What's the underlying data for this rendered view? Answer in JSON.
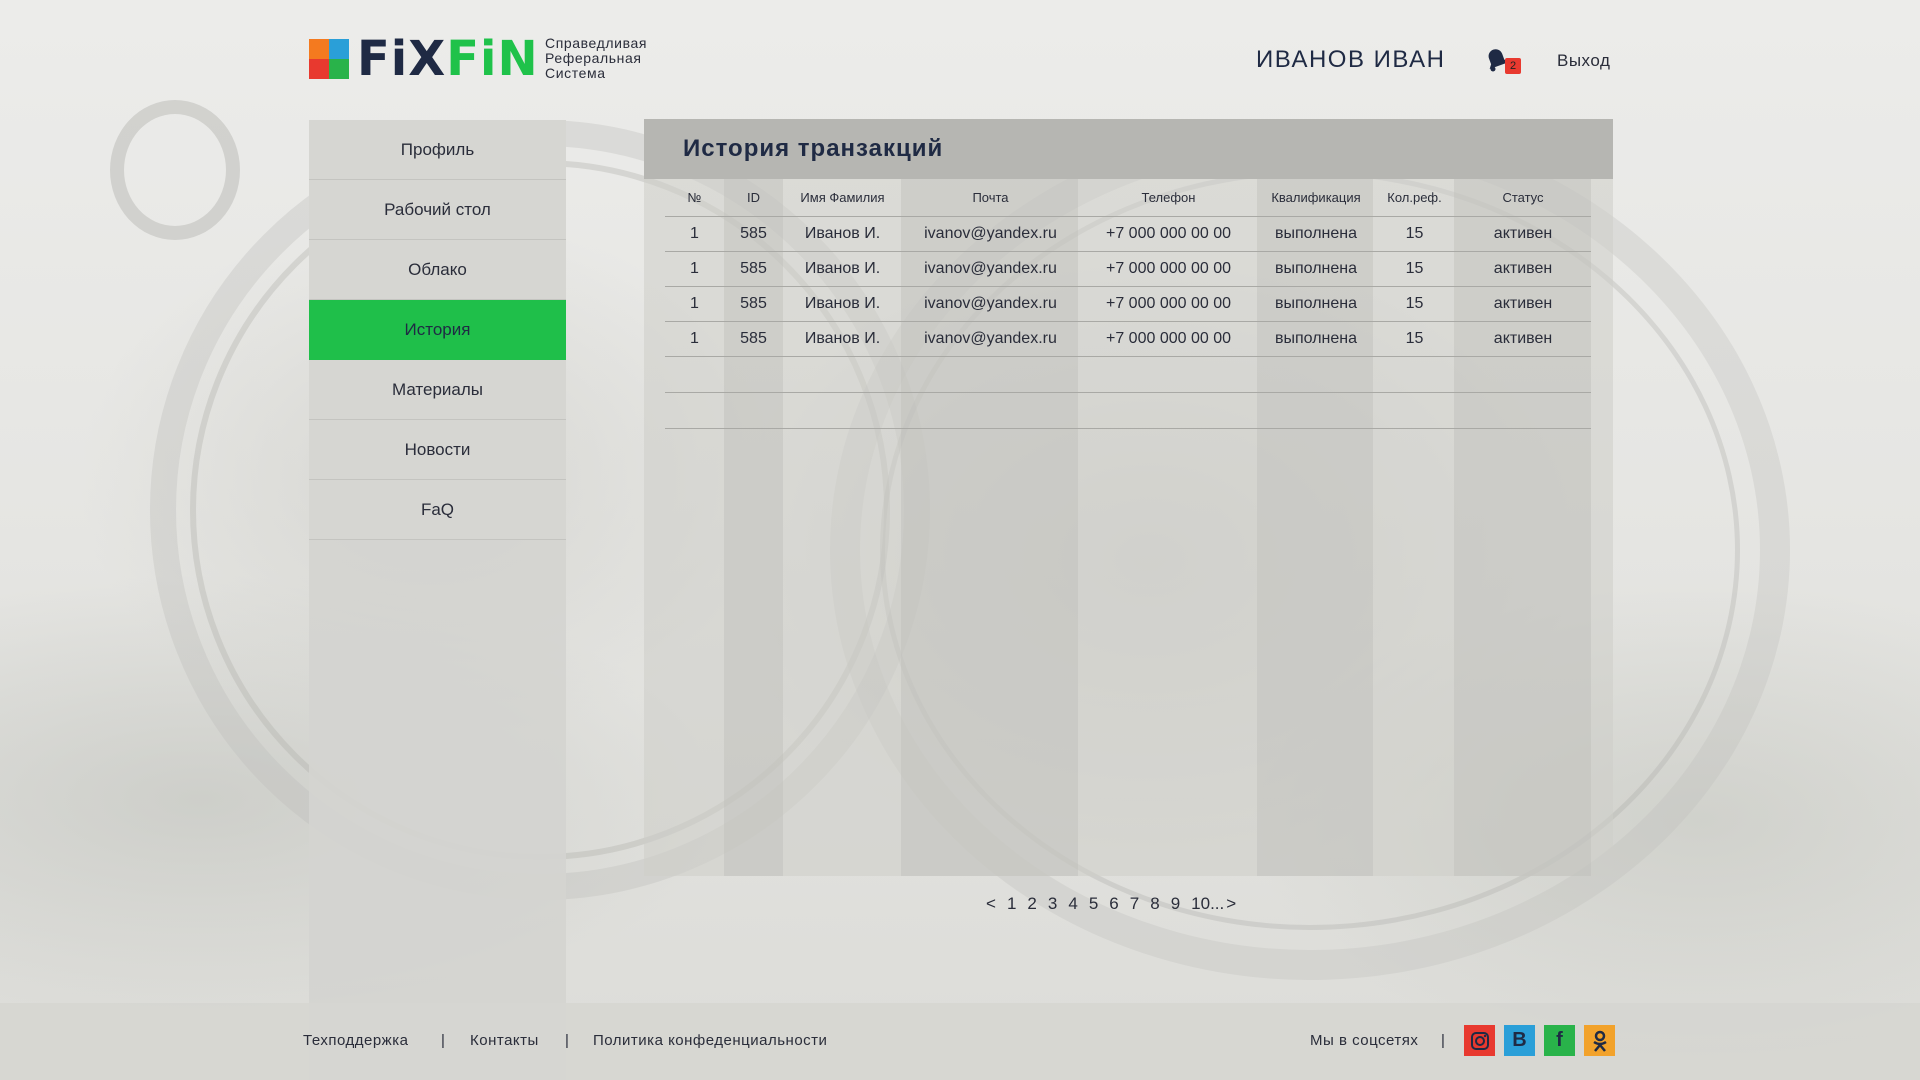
{
  "header": {
    "logo_fix": "FiX",
    "logo_fin": "FiN",
    "tagline": [
      "Справедливая",
      "Реферальная",
      "Система"
    ],
    "user_name": "ИВАНОВ ИВАН",
    "notifications_count": "2",
    "logout_label": "Выход"
  },
  "sidebar": {
    "items": [
      {
        "label": "Профиль",
        "active": false
      },
      {
        "label": "Рабочий стол",
        "active": false
      },
      {
        "label": "Облако",
        "active": false
      },
      {
        "label": "История",
        "active": true
      },
      {
        "label": "Материалы",
        "active": false
      },
      {
        "label": "Новости",
        "active": false
      },
      {
        "label": "FaQ",
        "active": false
      }
    ]
  },
  "main": {
    "title": "История транзакций",
    "columns": [
      "№",
      "ID",
      "Имя Фамилия",
      "Почта",
      "Телефон",
      "Квалификация",
      "Кол.реф.",
      "Статус"
    ],
    "rows": [
      [
        "1",
        "585",
        "Иванов И.",
        "ivanov@yandex.ru",
        "+7 000 000 00 00",
        "выполнена",
        "15",
        "активен"
      ],
      [
        "1",
        "585",
        "Иванов И.",
        "ivanov@yandex.ru",
        "+7 000 000 00 00",
        "выполнена",
        "15",
        "активен"
      ],
      [
        "1",
        "585",
        "Иванов И.",
        "ivanov@yandex.ru",
        "+7 000 000 00 00",
        "выполнена",
        "15",
        "активен"
      ],
      [
        "1",
        "585",
        "Иванов И.",
        "ivanov@yandex.ru",
        "+7 000 000 00 00",
        "выполнена",
        "15",
        "активен"
      ]
    ],
    "pagination": {
      "prev": "<",
      "pages": [
        "1",
        "2",
        "3",
        "4",
        "5",
        "6",
        "7",
        "8",
        "9",
        "10..."
      ],
      "next": ">"
    }
  },
  "footer": {
    "support": "Техподдержка",
    "contacts": "Контакты",
    "privacy": "Политика конфеденциальности",
    "social_label": "Мы в соцсетях",
    "separator": "|",
    "social_icons": [
      "instagram-icon",
      "vk-icon",
      "facebook-icon",
      "odnoklassniki-icon"
    ],
    "colors": {
      "instagram": "#e8392f",
      "vk": "#2a9fd8",
      "facebook": "#29b34a",
      "odnoklassniki": "#f2a22b"
    }
  },
  "colors": {
    "accent_green": "#1fbf4a",
    "brand_dark": "#1f2a44",
    "badge_red": "#e8392f"
  }
}
